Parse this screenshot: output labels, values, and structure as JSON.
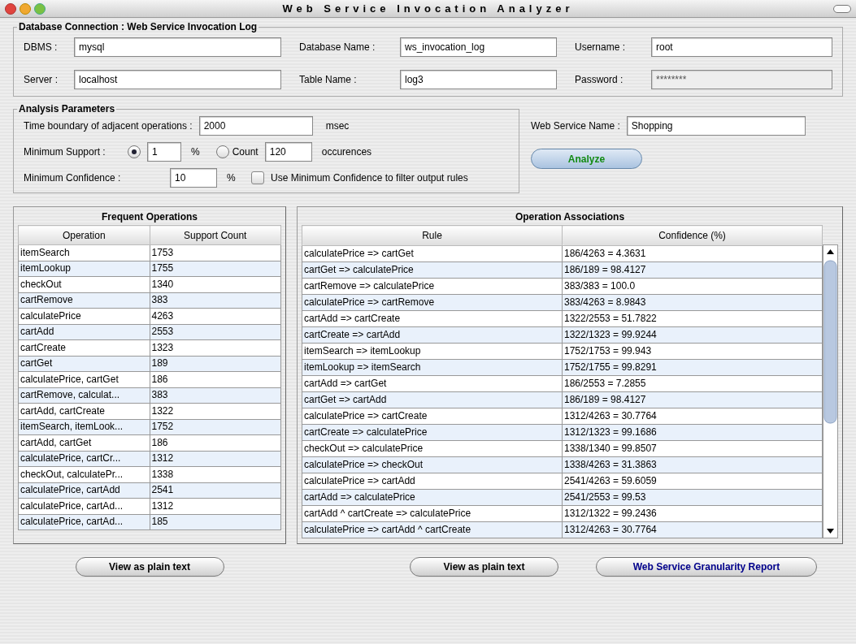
{
  "window": {
    "title": "Web Service Invocation Analyzer"
  },
  "database_connection": {
    "title": "Database Connection : Web Service Invocation Log",
    "fields": [
      {
        "label": "DBMS :",
        "value": "mysql",
        "disabled": false
      },
      {
        "label": "Database Name :",
        "value": "ws_invocation_log",
        "disabled": false
      },
      {
        "label": "Username :",
        "value": "root",
        "disabled": false
      },
      {
        "label": "Server :",
        "value": "localhost",
        "disabled": false
      },
      {
        "label": "Table Name :",
        "value": "log3",
        "disabled": false
      },
      {
        "label": "Password :",
        "value": "********",
        "disabled": true
      }
    ]
  },
  "analysis_parameters": {
    "title": "Analysis Parameters",
    "time_boundary": {
      "label": "Time boundary of adjacent operations :",
      "value": "2000",
      "unit": "msec"
    },
    "minimum_support": {
      "label": "Minimum Support :",
      "options": [
        {
          "kind": "percent",
          "selected": true,
          "value": "1",
          "unit": "%"
        },
        {
          "kind": "count",
          "selected": false,
          "label": "Count",
          "value": "120",
          "unit": "occurences"
        }
      ]
    },
    "minimum_confidence": {
      "label": "Minimum Confidence :",
      "value": "10",
      "unit": "%",
      "filter": {
        "label": "Use Minimum Confidence to filter output rules",
        "checked": false
      }
    }
  },
  "web_service": {
    "label": "Web Service Name :",
    "value": "Shopping"
  },
  "analyze_button": "Analyze",
  "frequent_operations": {
    "title": "Frequent Operations",
    "columns": [
      "Operation",
      "Support Count"
    ],
    "rows": [
      [
        "itemSearch",
        "1753"
      ],
      [
        "itemLookup",
        "1755"
      ],
      [
        "checkOut",
        "1340"
      ],
      [
        "cartRemove",
        "383"
      ],
      [
        "calculatePrice",
        "4263"
      ],
      [
        "cartAdd",
        "2553"
      ],
      [
        "cartCreate",
        "1323"
      ],
      [
        "cartGet",
        "189"
      ],
      [
        "calculatePrice, cartGet",
        "186"
      ],
      [
        "cartRemove, calculat...",
        "383"
      ],
      [
        "cartAdd, cartCreate",
        "1322"
      ],
      [
        "itemSearch, itemLook...",
        "1752"
      ],
      [
        "cartAdd, cartGet",
        "186"
      ],
      [
        "calculatePrice, cartCr...",
        "1312"
      ],
      [
        "checkOut, calculatePr...",
        "1338"
      ],
      [
        "calculatePrice, cartAdd",
        "2541"
      ],
      [
        "calculatePrice, cartAd...",
        "1312"
      ],
      [
        "calculatePrice, cartAd...",
        "185"
      ]
    ],
    "button": "View as plain text"
  },
  "operation_associations": {
    "title": "Operation Associations",
    "columns": [
      "Rule",
      "Confidence (%)"
    ],
    "rows": [
      [
        "calculatePrice => cartGet",
        "186/4263 = 4.3631"
      ],
      [
        "cartGet => calculatePrice",
        "186/189 = 98.4127"
      ],
      [
        "cartRemove => calculatePrice",
        "383/383 = 100.0"
      ],
      [
        "calculatePrice => cartRemove",
        "383/4263 = 8.9843"
      ],
      [
        "cartAdd => cartCreate",
        "1322/2553 = 51.7822"
      ],
      [
        "cartCreate => cartAdd",
        "1322/1323 = 99.9244"
      ],
      [
        "itemSearch => itemLookup",
        "1752/1753 = 99.943"
      ],
      [
        "itemLookup => itemSearch",
        "1752/1755 = 99.8291"
      ],
      [
        "cartAdd => cartGet",
        "186/2553 = 7.2855"
      ],
      [
        "cartGet => cartAdd",
        "186/189 = 98.4127"
      ],
      [
        "calculatePrice => cartCreate",
        "1312/4263 = 30.7764"
      ],
      [
        "cartCreate => calculatePrice",
        "1312/1323 = 99.1686"
      ],
      [
        "checkOut => calculatePrice",
        "1338/1340 = 99.8507"
      ],
      [
        "calculatePrice => checkOut",
        "1338/4263 = 31.3863"
      ],
      [
        "calculatePrice => cartAdd",
        "2541/4263 = 59.6059"
      ],
      [
        "cartAdd => calculatePrice",
        "2541/2553 = 99.53"
      ],
      [
        "cartAdd ^ cartCreate => calculatePrice",
        "1312/1322 = 99.2436"
      ],
      [
        "calculatePrice => cartAdd ^ cartCreate",
        "1312/4263 = 30.7764"
      ]
    ],
    "buttons": [
      "View as plain text",
      "Web Service Granularity Report"
    ]
  }
}
